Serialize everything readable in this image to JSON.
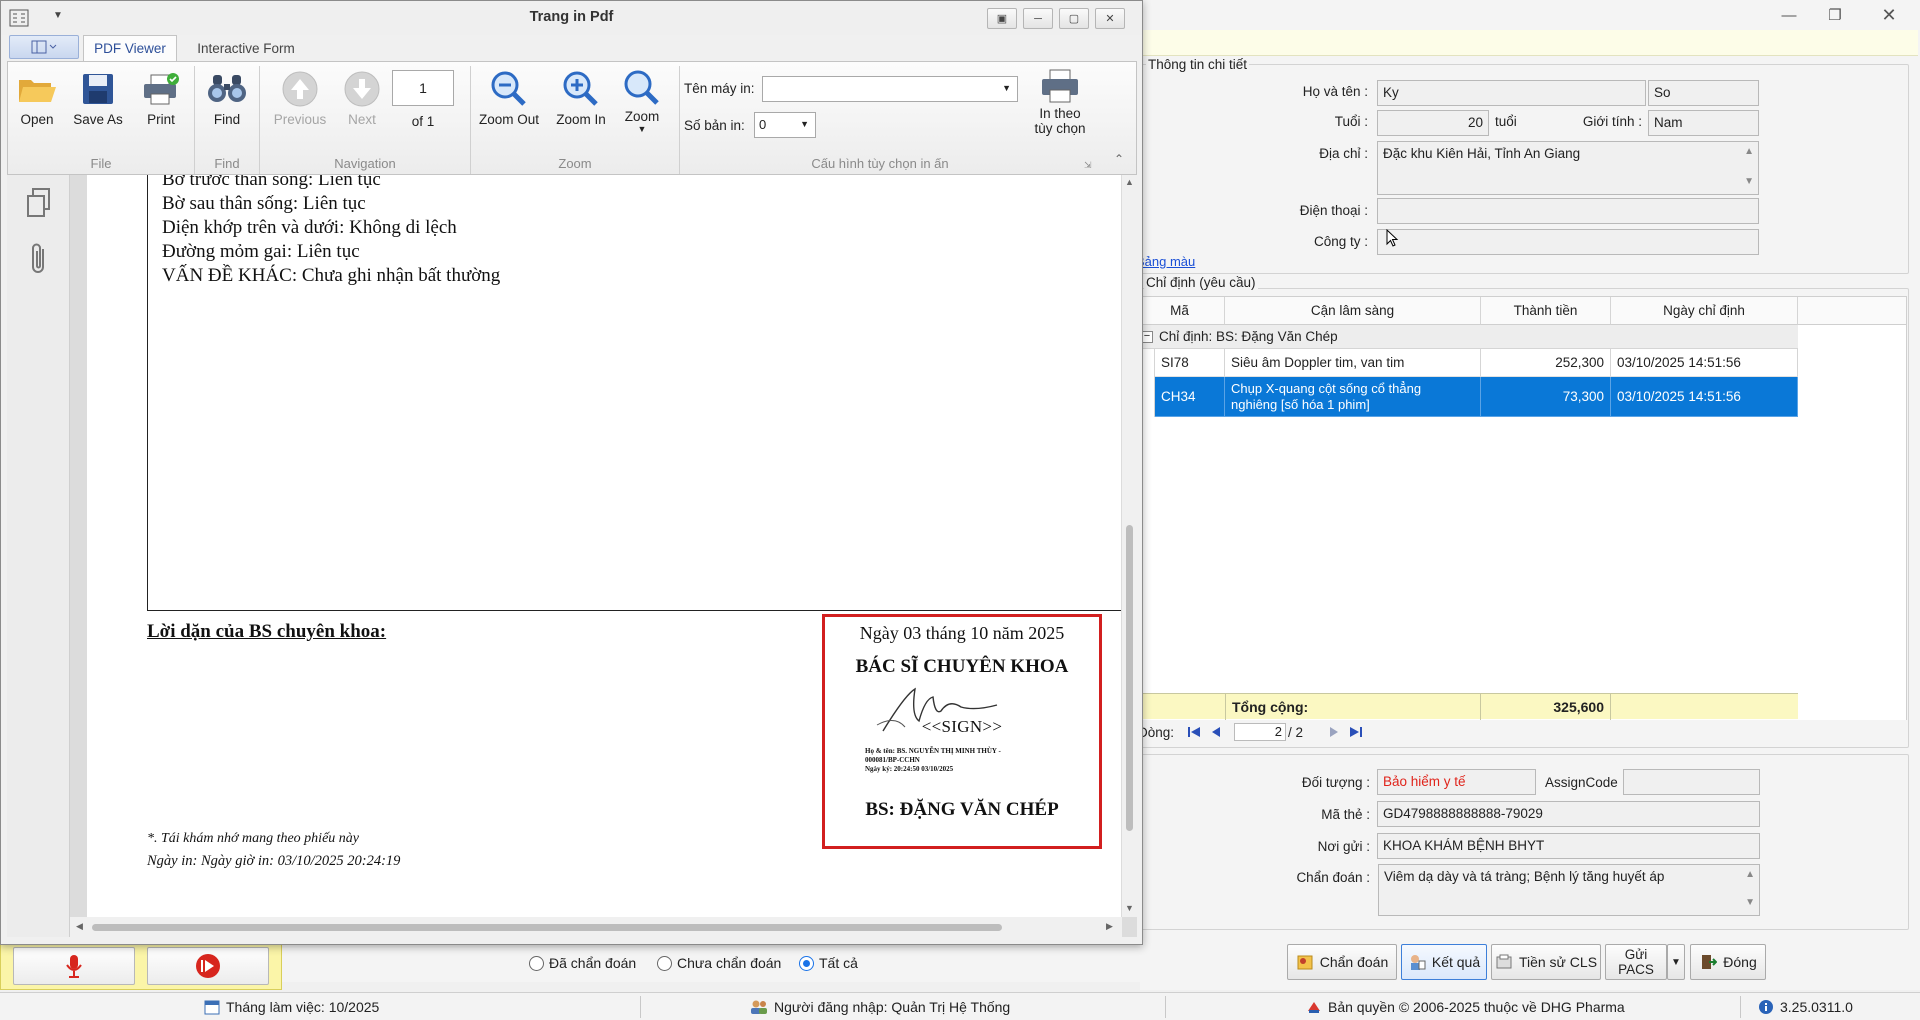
{
  "pdf_window": {
    "title": "Trang in Pdf",
    "tabs": [
      "PDF Viewer",
      "Interactive Form"
    ],
    "ribbon": {
      "file": {
        "open": "Open",
        "save_as": "Save As",
        "print": "Print",
        "group": "File"
      },
      "find": {
        "find": "Find",
        "group": "Find"
      },
      "navigation": {
        "previous": "Previous",
        "next": "Next",
        "page_value": "1",
        "of_label": "of 1",
        "group": "Navigation"
      },
      "zoom": {
        "zoom_out": "Zoom Out",
        "zoom_in": "Zoom In",
        "zoom": "Zoom",
        "group": "Zoom"
      },
      "print_config": {
        "printer_label": "Tên máy in:",
        "printer_value": "",
        "copies_label": "Số bản in:",
        "copies_value": "0",
        "print_options_line1": "In theo",
        "print_options_line2": "tùy chọn",
        "group": "Cấu hình tùy chọn in ấn"
      }
    },
    "document": {
      "lines": [
        "Bờ trước thân sống: Liên tục",
        "Bờ sau thân sống: Liên tục",
        "Diện khớp trên và dưới: Không di lệch",
        "Đường mỏm gai: Liên tục",
        "VẤN ĐỀ KHÁC: Chưa ghi nhận bất thường"
      ],
      "advice_heading": "Lời dặn của BS chuyên khoa:",
      "date_line": "Ngày 03 tháng 10 năm 2025",
      "role": "BÁC SĨ CHUYÊN KHOA",
      "sign_placeholder": "<<SIGN>>",
      "sign_meta_1": "Họ & tên:     BS. NGUYỄN THỊ MINH THÙY -",
      "sign_meta_2": "000081/BP-CCHN",
      "sign_meta_3": "Ngày ký:        20:24:50 03/10/2025",
      "doctor": "BS: ĐẶNG VĂN CHÉP",
      "footer_note": "*. Tái khám nhớ mang theo phiếu này",
      "print_time": "Ngày in: Ngày giờ in: 03/10/2025 20:24:19"
    }
  },
  "main_window": {
    "details_group": "Thông tin chi tiết",
    "patient": {
      "name_label": "Họ và tên :",
      "name_first": "Ky",
      "name_last": "So",
      "age_label": "Tuổi :",
      "age_value": "20",
      "age_unit": "tuổi",
      "gender_label": "Giới tính :",
      "gender_value": "Nam",
      "address_label": "Địa chỉ :",
      "address_value": "Đặc khu Kiên Hải, Tỉnh An Giang",
      "phone_label": "Điện thoại :",
      "phone_value": "",
      "company_label": "Công ty :",
      "company_value": ""
    },
    "color_link": "Bảng màu",
    "orders_group": "Chỉ định (yêu cầu)",
    "table": {
      "headers": [
        "Mã",
        "Cận lâm sàng",
        "Thành tiền",
        "Ngày chỉ định"
      ],
      "group_row": "Chỉ định:  BS: Đặng Văn Chép",
      "rows": [
        {
          "code": "SI78",
          "name": "Siêu âm Doppler tim, van tim",
          "amount": "252,300",
          "date": "03/10/2025 14:51:56"
        },
        {
          "code": "CH34",
          "name_line1": "Chụp X-quang cột sống cổ thẳng",
          "name_line2": "nghiêng [số hóa 1 phim]",
          "amount": "73,300",
          "date": "03/10/2025 14:51:56"
        }
      ],
      "total_label": "Tổng cộng:",
      "total_value": "325,600",
      "pager_label": "Dòng:",
      "pager_current": "2",
      "pager_total": "/  2"
    },
    "insurance": {
      "object_label": "Đối tượng :",
      "object_value": "Bảo hiểm y tế",
      "assign_label": "AssignCode",
      "assign_value": "",
      "card_label": "Mã thẻ :",
      "card_value": "GD4798888888888-79029",
      "sender_label": "Nơi gửi :",
      "sender_value": "KHOA KHÁM BỆNH BHYT",
      "diagnosis_label": "Chẩn đoán :",
      "diagnosis_value": "Viêm dạ dày và tá tràng; Bệnh lý tăng huyết áp"
    },
    "buttons": {
      "diagnose": "Chẩn đoán",
      "result": "Kết quả",
      "history": "Tiền sử CLS",
      "send_pacs_1": "Gửi",
      "send_pacs_2": "PACS",
      "close": "Đóng"
    },
    "filters": {
      "diagnosed": "Đã chẩn đoán",
      "not_diagnosed": "Chưa chẩn đoán",
      "all": "Tất cả"
    }
  },
  "status_bar": {
    "working_month": "Tháng làm việc: 10/2025",
    "user": "Người đăng nhập: Quản Trị Hệ Thống",
    "copyright": "Bản quyền © 2006-2025 thuộc về DHG Pharma",
    "version": "3.25.0311.0"
  },
  "colors": {
    "selection": "#0a78d7",
    "total_bg": "#fbf8c2",
    "insurance_red": "#e0241b",
    "signature_border": "#d21f1f"
  }
}
